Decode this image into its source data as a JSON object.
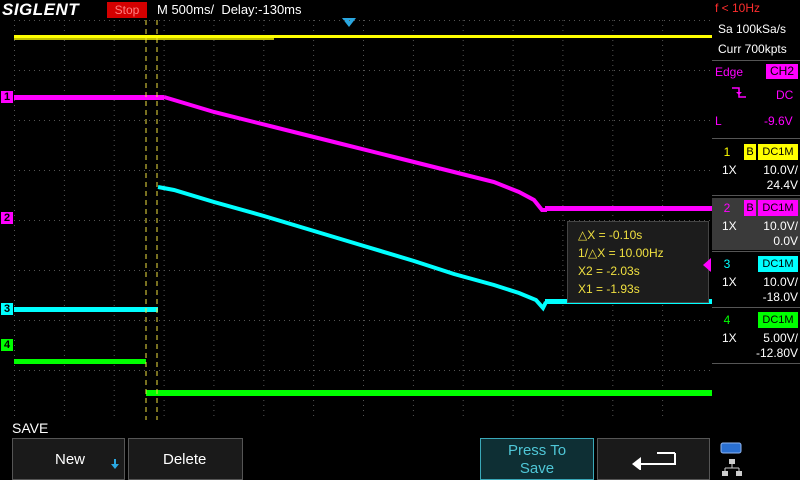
{
  "topbar": {
    "logo": "SIGLENT",
    "run_status": "Stop",
    "timebase": "M 500ms/",
    "delay": "Delay:-130ms",
    "trigger_freq": "f < 10Hz"
  },
  "acquisition": {
    "sample_rate": "Sa 100kSa/s",
    "memory": "Curr 700kpts"
  },
  "trigger": {
    "type": "Edge",
    "source": "CH2",
    "coupling": "DC",
    "level_label": "L",
    "level": "-9.6V"
  },
  "channels": [
    {
      "num": "1",
      "b": "B",
      "coupling": "DC1M",
      "probe": "1X",
      "scale": "10.0V/",
      "offset": "24.4V",
      "color": "#ffff00"
    },
    {
      "num": "2",
      "b": "B",
      "coupling": "DC1M",
      "probe": "1X",
      "scale": "10.0V/",
      "offset": "0.0V",
      "color": "#ff00ff"
    },
    {
      "num": "3",
      "b": "",
      "coupling": "DC1M",
      "probe": "1X",
      "scale": "10.0V/",
      "offset": "-18.0V",
      "color": "#00ffff"
    },
    {
      "num": "4",
      "b": "",
      "coupling": "DC1M",
      "probe": "1X",
      "scale": "5.00V/",
      "offset": "-12.80V",
      "color": "#00ff00"
    }
  ],
  "cursors": {
    "dx": "△X = -0.10s",
    "inv_dx": "1/△X = 10.00Hz",
    "x2": "X2 = -2.03s",
    "x1": "X1 = -1.93s"
  },
  "channel_markers": [
    "1",
    "2",
    "3",
    "4"
  ],
  "menu": {
    "title": "SAVE",
    "buttons": {
      "new": "New",
      "delete": "Delete",
      "press_to": "Press To",
      "save": "Save"
    }
  },
  "colors": {
    "ch1": "#ffff00",
    "ch2": "#ff00ff",
    "ch3": "#00ffff",
    "ch4": "#00ff00",
    "cursor": "#f0e040",
    "stop": "#d40000",
    "accent": "#3aa8b8"
  },
  "icons": [
    "down-arrow-icon",
    "return-arrow-icon",
    "usb-icon",
    "network-icon",
    "trigger-edge-icon"
  ]
}
